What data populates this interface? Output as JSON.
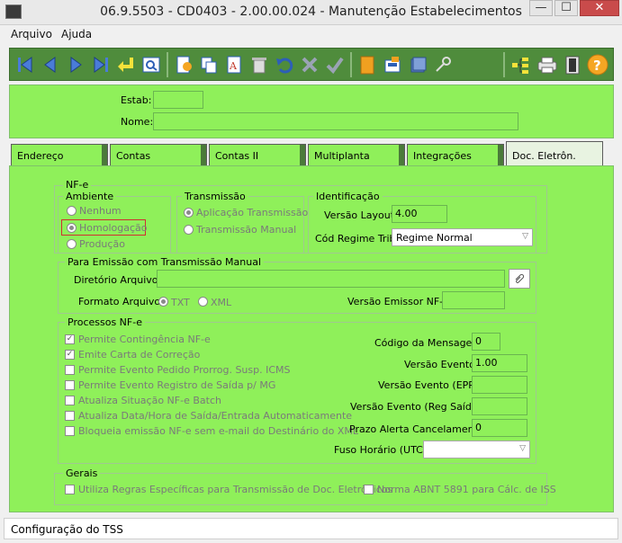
{
  "window": {
    "title": "06.9.5503 - CD0403 - 2.00.00.024 - Manutenção Estabelecimentos",
    "minimize": "—",
    "maximize": "☐",
    "close": "✕"
  },
  "menu": [
    "Arquivo",
    "Ajuda"
  ],
  "header": {
    "estab_label": "Estab:",
    "estab_value": "",
    "nome_label": "Nome:",
    "nome_value": ""
  },
  "tabs": [
    {
      "label": "Endereço"
    },
    {
      "label": "Contas"
    },
    {
      "label": "Contas II"
    },
    {
      "label": "Multiplanta"
    },
    {
      "label": "Integrações"
    },
    {
      "label": "Doc. Eletrôn."
    }
  ],
  "nfe": {
    "title": "NF-e",
    "ambiente": {
      "title": "Ambiente",
      "options": [
        "Nenhum",
        "Homologação",
        "Produção"
      ],
      "selected": "Homologação"
    },
    "transmissao": {
      "title": "Transmissão",
      "options": [
        "Aplicação Transmissão",
        "Transmissão Manual"
      ],
      "selected": "Aplicação Transmissão"
    },
    "identificacao": {
      "title": "Identificação",
      "versao_layout_label": "Versão Layout:",
      "versao_layout_value": "4.00",
      "cod_regime_label": "Cód Regime Trib:",
      "cod_regime_value": "Regime Normal"
    }
  },
  "manual": {
    "title": "Para Emissão com Transmissão Manual",
    "diretorio_label": "Diretório Arquivos:",
    "diretorio_value": "",
    "formato_label": "Formato Arquivo:",
    "formato_options": [
      "TXT",
      "XML"
    ],
    "formato_selected": "TXT",
    "versao_emissor_label": "Versão Emissor NF-e:",
    "versao_emissor_value": ""
  },
  "processos": {
    "title": "Processos NF-e",
    "checks": [
      {
        "label": "Permite Contingência NF-e",
        "checked": true
      },
      {
        "label": "Emite Carta de Correção",
        "checked": true
      },
      {
        "label": "Permite Evento Pedido Prorrog. Susp. ICMS",
        "checked": false
      },
      {
        "label": "Permite Evento Registro de Saída p/ MG",
        "checked": false
      },
      {
        "label": "Atualiza Situação NF-e Batch",
        "checked": false
      },
      {
        "label": "Atualiza Data/Hora de Saída/Entrada Automaticamente",
        "checked": false
      },
      {
        "label": "Bloqueia emissão NF-e sem e-mail do Destinário do XML",
        "checked": false
      }
    ],
    "fields": {
      "codigo_mensagem_label": "Código da Mensagem:",
      "codigo_mensagem_value": "0",
      "versao_evento_label": "Versão Evento:",
      "versao_evento_value": "1.00",
      "versao_evento_epp_label": "Versão Evento (EPP):",
      "versao_evento_epp_value": "",
      "versao_evento_reg_label": "Versão Evento (Reg Saída):",
      "versao_evento_reg_value": "",
      "prazo_alerta_label": "Prazo Alerta Cancelamento:",
      "prazo_alerta_value": "0",
      "fuso_horario_label": "Fuso Horário (UTC):",
      "fuso_horario_value": ""
    }
  },
  "gerais": {
    "title": "Gerais",
    "checks": [
      {
        "label": "Utiliza Regras Específicas para Transmissão de Doc. Eletrônicos",
        "checked": false
      },
      {
        "label": "Norma ABNT 5891 para Cálc. de ISS",
        "checked": false
      }
    ]
  },
  "status": "Configuração do TSS",
  "colors": {
    "panel_green": "#8ff05a",
    "toolbar_green": "#4f8c3c",
    "homologacao_highlight": "#d03030"
  },
  "toolbar_icons": [
    "first-icon",
    "prev-icon",
    "next-icon",
    "last-icon",
    "goto-icon",
    "search-icon",
    "add-icon",
    "copy-icon",
    "edit-icon",
    "delete-icon",
    "undo-icon",
    "cancel-icon",
    "confirm-icon",
    "book-icon",
    "report-icon",
    "list-icon",
    "key-icon",
    "tree-icon",
    "print-icon",
    "exit-icon",
    "help-icon"
  ]
}
